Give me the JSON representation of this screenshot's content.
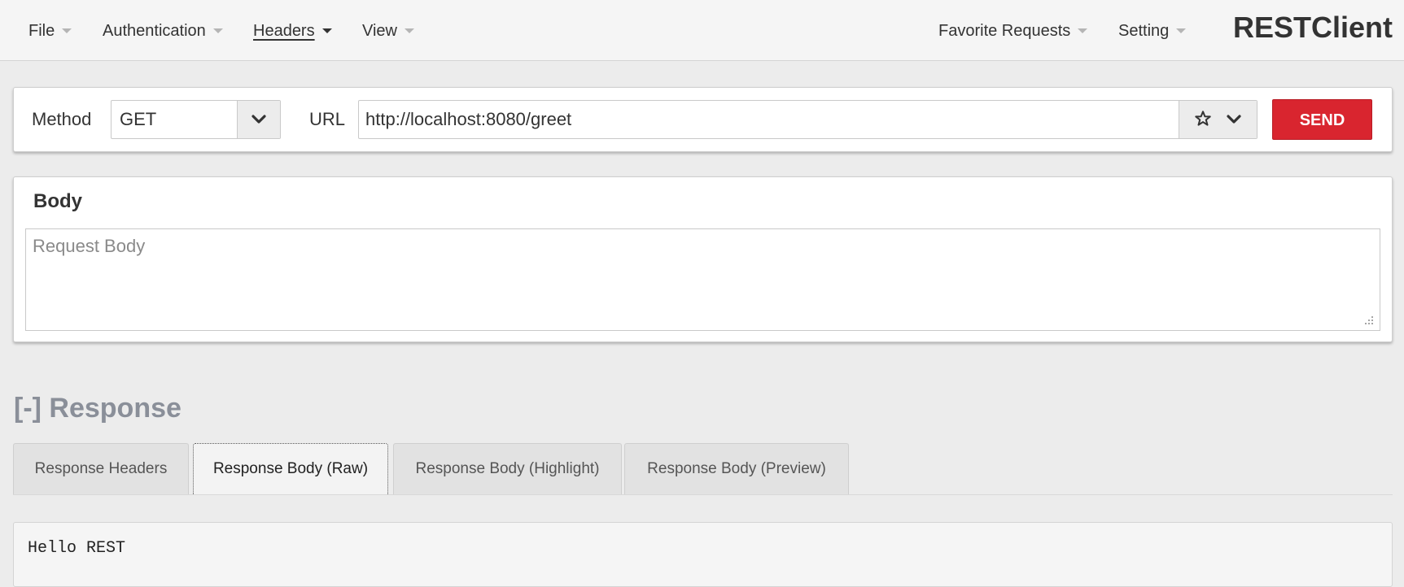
{
  "menu": {
    "file": "File",
    "authentication": "Authentication",
    "headers": "Headers",
    "view": "View",
    "favorite_requests": "Favorite Requests",
    "setting": "Setting",
    "brand": "RESTClient"
  },
  "request": {
    "method_label": "Method",
    "method_value": "GET",
    "url_label": "URL",
    "url_value": "http://localhost:8080/greet",
    "send_label": "SEND"
  },
  "body": {
    "title": "Body",
    "placeholder": "Request Body"
  },
  "response": {
    "title": "[-] Response",
    "tabs": [
      {
        "label": "Response Headers",
        "active": false
      },
      {
        "label": "Response Body (Raw)",
        "active": true
      },
      {
        "label": "Response Body (Highlight)",
        "active": false
      },
      {
        "label": "Response Body (Preview)",
        "active": false
      }
    ],
    "content": "Hello REST"
  },
  "icons": {
    "dropdown": "chevron-down-icon",
    "favorite": "star-icon",
    "menu_caret": "caret-down-icon"
  },
  "colors": {
    "send_button": "#d9252f",
    "response_title": "#8a8f99"
  }
}
